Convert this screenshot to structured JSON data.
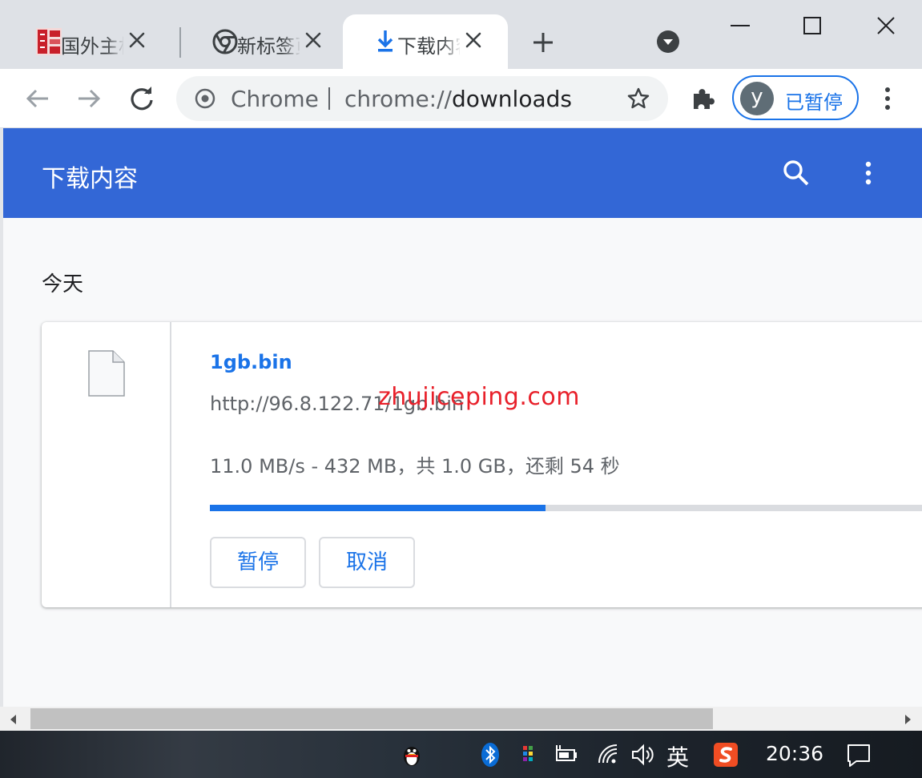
{
  "tabs": [
    {
      "title": "国外主机测评",
      "active": false,
      "icon": "red-seal-favicon"
    },
    {
      "title": "新标签页",
      "active": false,
      "icon": "chrome-icon"
    },
    {
      "title": "下载内容",
      "active": true,
      "icon": "download-icon"
    }
  ],
  "omnibox": {
    "chip": "Chrome",
    "url_scheme": "chrome://",
    "url_host": "downloads"
  },
  "profile": {
    "initial": "y",
    "status": "已暂停"
  },
  "downloads_page": {
    "title": "下载内容",
    "section_date": "今天",
    "items": [
      {
        "file_name": "1gb.bin",
        "url": "http://96.8.122.71/1gb.bin",
        "status": "11.0 MB/s - 432 MB，共 1.0 GB，还剩 54 秒",
        "progress": 0.46,
        "pause_label": "暂停",
        "cancel_label": "取消"
      }
    ]
  },
  "watermark": "zhujiceping.com",
  "taskbar": {
    "input_language": "英",
    "clock": "20:36"
  },
  "colors": {
    "accent": "#1a73e8",
    "appbar": "#3367d6",
    "watermark": "#e8202a"
  }
}
